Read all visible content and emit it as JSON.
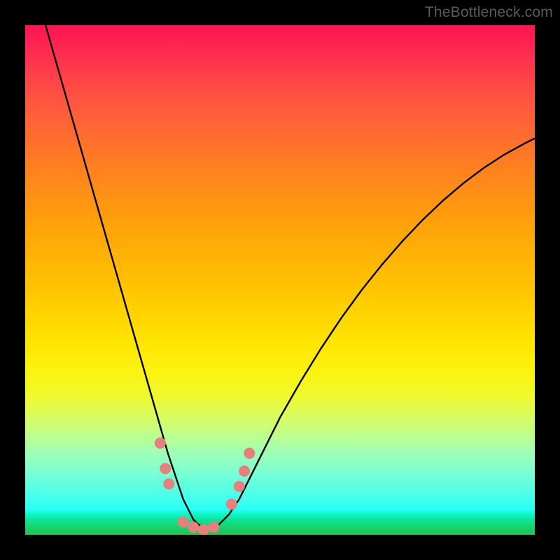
{
  "watermark": "TheBottleneck.com",
  "chart_data": {
    "type": "line",
    "title": "",
    "xlabel": "",
    "ylabel": "",
    "xlim": [
      0,
      100
    ],
    "ylim": [
      0,
      100
    ],
    "grid": false,
    "series": [
      {
        "name": "bottleneck-curve",
        "color": "#000000",
        "x": [
          4,
          6,
          8,
          10,
          12,
          14,
          16,
          18,
          20,
          22,
          24,
          26,
          27,
          28,
          29,
          30,
          31,
          32,
          33,
          34,
          35,
          36,
          37,
          38,
          40,
          42,
          44,
          46,
          48,
          50,
          54,
          58,
          62,
          66,
          70,
          74,
          78,
          82,
          86,
          90,
          94,
          98,
          100
        ],
        "y": [
          100,
          93,
          86,
          79,
          72,
          65,
          58,
          51,
          44,
          37,
          30,
          23,
          19.5,
          16,
          13,
          10,
          7,
          5,
          3,
          2,
          1.5,
          1,
          1.2,
          2,
          4,
          7,
          11,
          15,
          19,
          23,
          30,
          36.5,
          42.5,
          48,
          53,
          57.6,
          61.8,
          65.6,
          69,
          72,
          74.6,
          76.8,
          77.8
        ]
      }
    ],
    "markers": [
      {
        "name": "point-left-1",
        "x": 26.5,
        "y": 18,
        "r": 1.1
      },
      {
        "name": "point-left-2",
        "x": 27.5,
        "y": 13,
        "r": 1.1
      },
      {
        "name": "point-left-3",
        "x": 28.2,
        "y": 10,
        "r": 1.1
      },
      {
        "name": "point-bottom-1",
        "x": 31,
        "y": 2.5,
        "r": 1.1
      },
      {
        "name": "point-bottom-2",
        "x": 33,
        "y": 1.5,
        "r": 1.1
      },
      {
        "name": "point-bottom-3",
        "x": 35,
        "y": 1,
        "r": 1.1
      },
      {
        "name": "point-bottom-4",
        "x": 37,
        "y": 1.5,
        "r": 1.1
      },
      {
        "name": "point-right-1",
        "x": 40.5,
        "y": 6,
        "r": 1.1
      },
      {
        "name": "point-right-2",
        "x": 42,
        "y": 9.5,
        "r": 1.1
      },
      {
        "name": "point-right-3",
        "x": 43,
        "y": 12.5,
        "r": 1.1
      },
      {
        "name": "point-right-4",
        "x": 44,
        "y": 16,
        "r": 1.1
      }
    ],
    "marker_color": "#e77f7d",
    "background_gradient": {
      "stops": [
        {
          "pos": 0.0,
          "color": "#ff1356"
        },
        {
          "pos": 0.5,
          "color": "#ffd400"
        },
        {
          "pos": 0.8,
          "color": "#d6fc62"
        },
        {
          "pos": 0.96,
          "color": "#0ef5c7"
        },
        {
          "pos": 1.0,
          "color": "#20c651"
        }
      ]
    }
  }
}
